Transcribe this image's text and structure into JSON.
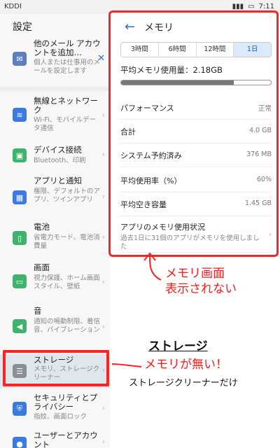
{
  "statusbar": {
    "carrier": "KDDI",
    "time": "7:11"
  },
  "left": {
    "title": "設定",
    "mail_item": {
      "title": "他のメール アカウントを追加…",
      "sub": "個人または仕事用のメールを設定します",
      "close": "✕"
    },
    "items": [
      {
        "title": "無線とネットワーク",
        "sub": "Wi-Fi、モバイルデータ通信",
        "icon": "wifi-icon"
      },
      {
        "title": "デバイス接続",
        "sub": "Bluetooth、印刷",
        "icon": "device-connect-icon"
      },
      {
        "title": "アプリと通知",
        "sub": "権限、デフォルトのアプリ、ツインアプリ",
        "icon": "apps-icon"
      },
      {
        "title": "電池",
        "sub": "省電力モード、電池消費量",
        "icon": "battery-icon"
      },
      {
        "title": "画面",
        "sub": "視力保護、ホーム画面スタイル、壁紙",
        "icon": "display-icon"
      },
      {
        "title": "音",
        "sub": "通知の鳴動制限、着信音、バイブレーション",
        "icon": "sound-icon"
      },
      {
        "title": "ストレージ",
        "sub": "メモリ、ストレージクリーナー",
        "icon": "storage-icon"
      },
      {
        "title": "セキュリティとプライバシー",
        "sub": "指紋、画面ロック",
        "icon": "security-icon"
      },
      {
        "title": "ユーザーとアカウント",
        "sub": "",
        "icon": "user-icon"
      }
    ]
  },
  "right": {
    "title": "メモリ",
    "tabs": [
      "3時間",
      "6時間",
      "12時間",
      "1日"
    ],
    "active_tab": "1日",
    "avg_label": "平均メモリ使用量：2.18GB",
    "usage_fraction": 0.75,
    "rows": [
      {
        "k": "パフォーマンス",
        "v": "正常"
      },
      {
        "k": "合計",
        "v": "4.0 GB"
      },
      {
        "k": "システム予約済み",
        "v": "376 MB"
      },
      {
        "k": "平均使用率（%）",
        "v": "60%"
      },
      {
        "k": "平均空き容量",
        "v": "1.45 GB"
      }
    ],
    "app_usage": {
      "title": "アプリのメモリ使用状況",
      "desc": "過去1日に31個のアプリがメモリを使用しました"
    }
  },
  "annotations": {
    "memory_not_shown_line1": "メモリ画面",
    "memory_not_shown_line2": "表示されない",
    "storage_label": "ストレージ",
    "no_memory": "メモリが無い！",
    "cleaner_only": "ストレージクリーナーだけ"
  },
  "colors": {
    "accent": "#2a72c9",
    "annotation_red": "#ff2222"
  }
}
